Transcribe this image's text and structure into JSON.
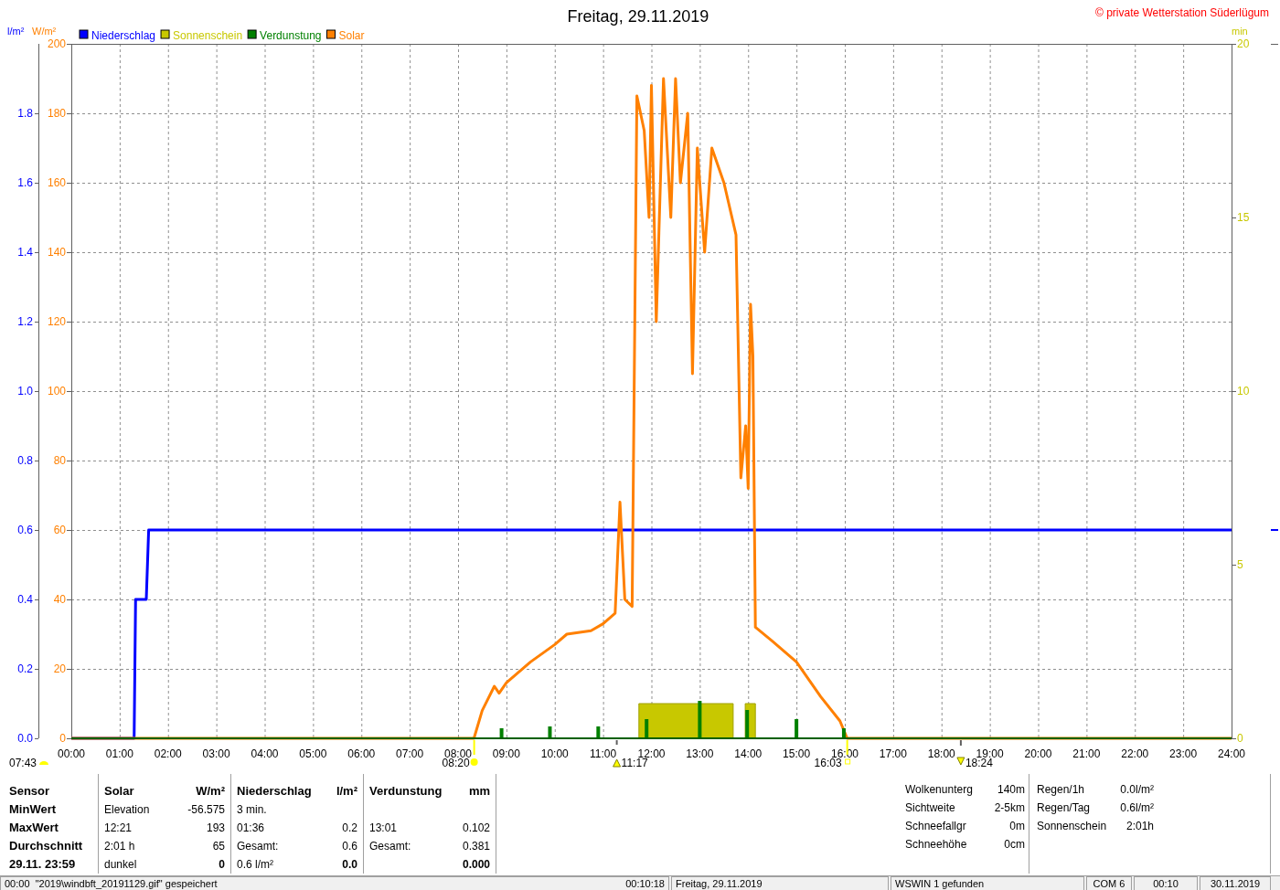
{
  "header": {
    "title": "Freitag, 29.11.2019",
    "copyright": "© private Wetterstation Süderlügum"
  },
  "chart": {
    "evaporation_legend": {
      "label": "Verdunstung",
      "color": "#008000"
    },
    "charts": [
      {
        "chart_data": {
          "type": "line",
          "ylabel": "l/m²",
          "xlim": [
            0,
            24
          ],
          "ylim": [
            0,
            2
          ],
          "yticks": [
            {
              "value": 1.8,
              "label": "1.8"
            },
            {
              "value": 1.6,
              "label": "1.6"
            },
            {
              "value": 1.4,
              "label": "1.4"
            },
            {
              "value": 1.2,
              "label": "1.2"
            },
            {
              "value": 1,
              "label": "1.0"
            },
            {
              "value": 0.8,
              "label": "0.8"
            },
            {
              "value": 0.6,
              "label": "0.6"
            },
            {
              "value": 0.4,
              "label": "0.4"
            },
            {
              "value": 0.2,
              "label": "0.2"
            },
            {
              "value": 0,
              "label": "0.0"
            }
          ],
          "x": [
            0,
            1.3,
            1.33,
            1.38,
            1.55,
            1.6,
            24
          ],
          "series": [
            {
              "name": "Niederschlag",
              "color": "#0000ff",
              "values": [
                0,
                0,
                0.4,
                0.4,
                0.4,
                0.6,
                0.6
              ]
            }
          ]
        }
      },
      {
        "chart_data": {
          "type": "area",
          "ylabel": "min",
          "xlim": [
            0,
            24
          ],
          "ylim": [
            0,
            20
          ],
          "yticks": [
            20,
            15,
            10,
            5,
            0
          ],
          "x": [
            11.74,
            11.74,
            13.69,
            13.69,
            13.94,
            13.94,
            14.15,
            14.15
          ],
          "series": [
            {
              "name": "Sonnenschein",
              "color": "#c8c800",
              "values": [
                0,
                1,
                1,
                0,
                0,
                1,
                1,
                0
              ]
            }
          ]
        }
      },
      {
        "chart_data": {
          "type": "line",
          "ylabel": "W/m²",
          "xlim": [
            0,
            24
          ],
          "ylim": [
            0,
            200
          ],
          "grid": true,
          "xticks": [
            {
              "value": 0,
              "label": "00:00"
            },
            {
              "value": 1,
              "label": "01:00"
            },
            {
              "value": 2,
              "label": "02:00"
            },
            {
              "value": 3,
              "label": "03:00"
            },
            {
              "value": 4,
              "label": "04:00"
            },
            {
              "value": 5,
              "label": "05:00"
            },
            {
              "value": 6,
              "label": "06:00"
            },
            {
              "value": 7,
              "label": "07:00"
            },
            {
              "value": 8,
              "label": "08:00"
            },
            {
              "value": 9,
              "label": "09:00"
            },
            {
              "value": 10,
              "label": "10:00"
            },
            {
              "value": 11,
              "label": "11:00"
            },
            {
              "value": 12,
              "label": "12:00"
            },
            {
              "value": 13,
              "label": "13:00"
            },
            {
              "value": 14,
              "label": "14:00"
            },
            {
              "value": 15,
              "label": "15:00"
            },
            {
              "value": 16,
              "label": "16:00"
            },
            {
              "value": 17,
              "label": "17:00"
            },
            {
              "value": 18,
              "label": "18:00"
            },
            {
              "value": 19,
              "label": "19:00"
            },
            {
              "value": 20,
              "label": "20:00"
            },
            {
              "value": 21,
              "label": "21:00"
            },
            {
              "value": 22,
              "label": "22:00"
            },
            {
              "value": 23,
              "label": "23:00"
            },
            {
              "value": 24,
              "label": "24:00"
            }
          ],
          "yticks": [
            200,
            180,
            160,
            140,
            120,
            100,
            80,
            60,
            40,
            20,
            0
          ],
          "x": [
            0,
            8.33,
            8.5,
            8.75,
            8.85,
            9,
            9.5,
            10,
            10.25,
            10.75,
            11,
            11.25,
            11.35,
            11.45,
            11.6,
            11.7,
            11.85,
            11.95,
            12,
            12.1,
            12.25,
            12.4,
            12.5,
            12.6,
            12.75,
            12.85,
            12.95,
            13.1,
            13.25,
            13.5,
            13.75,
            13.85,
            13.95,
            14,
            14.05,
            14.1,
            14.15,
            14.5,
            15,
            15.5,
            15.9,
            16.05,
            24
          ],
          "series": [
            {
              "name": "Solar",
              "color": "#ff8000",
              "values": [
                0,
                0,
                8,
                15,
                13,
                16,
                22,
                27,
                30,
                31,
                33,
                36,
                68,
                40,
                38,
                185,
                175,
                150,
                188,
                120,
                190,
                150,
                190,
                160,
                180,
                105,
                170,
                140,
                170,
                160,
                145,
                75,
                90,
                72,
                125,
                110,
                32,
                28,
                22,
                12,
                5,
                0,
                0
              ]
            }
          ]
        }
      }
    ],
    "sun_events": [
      {
        "kind": "dawn",
        "time": "07:43"
      },
      {
        "kind": "sunrise",
        "time": "08:20"
      },
      {
        "kind": "noon",
        "time": "11:17"
      },
      {
        "kind": "sunset",
        "time": "16:03"
      },
      {
        "kind": "moon",
        "time": "18:24"
      }
    ]
  },
  "stats": {
    "row_labels": [
      "Sensor",
      "MinWert",
      "MaxWert",
      "Durchschnitt",
      "29.11. 23:59"
    ],
    "columns": [
      {
        "title": "Solar",
        "unit": "W/m²",
        "rows": [
          {
            "label": "Elevation",
            "value": "-56.575"
          },
          {
            "label": "12:21",
            "value": "193"
          },
          {
            "label": "2:01 h",
            "value": "65"
          },
          {
            "label": "dunkel",
            "value": "0"
          }
        ]
      },
      {
        "title": "Niederschlag",
        "unit": "l/m²",
        "rows": [
          {
            "label": "3 min."
          },
          {
            "label": "01:36",
            "value": "0.2"
          },
          {
            "label": "Gesamt:",
            "value": "0.6"
          },
          {
            "label": "0.6 l/m²",
            "value": "0.0"
          }
        ]
      },
      {
        "title": "Verdunstung",
        "unit": "mm",
        "rows": [
          {},
          {
            "label": "13:01",
            "value": "0.102"
          },
          {
            "label": "Gesamt:",
            "value": "0.381"
          },
          {
            "value": "0.000"
          }
        ]
      }
    ]
  },
  "weather_info": [
    {
      "label": "Wolkenunterg",
      "value": "140m"
    },
    {
      "label": "Sichtweite",
      "value": "2-5km"
    },
    {
      "label": "Schneefallgr",
      "value": "0m"
    },
    {
      "label": "Schneehöhe",
      "value": "0cm"
    }
  ],
  "rain_info": [
    {
      "label": "Regen/1h",
      "value": "0.0l/m²"
    },
    {
      "label": "Regen/Tag",
      "value": "0.6l/m²"
    },
    {
      "label": "Sonnenschein",
      "value": "2:01h"
    }
  ],
  "status_bar": [
    {
      "texts": [
        "00:00  \"2019\\windbft_20191129.gif\" gespeichert",
        "00:10:18"
      ]
    },
    {
      "texts": [
        "Freitag, 29.11.2019"
      ]
    },
    {
      "texts": [
        "WSWIN 1 gefunden"
      ]
    },
    {
      "texts": [
        "COM 6"
      ]
    },
    {
      "texts": [
        "00:10"
      ]
    },
    {
      "texts": [
        "30.11.2019"
      ]
    }
  ]
}
